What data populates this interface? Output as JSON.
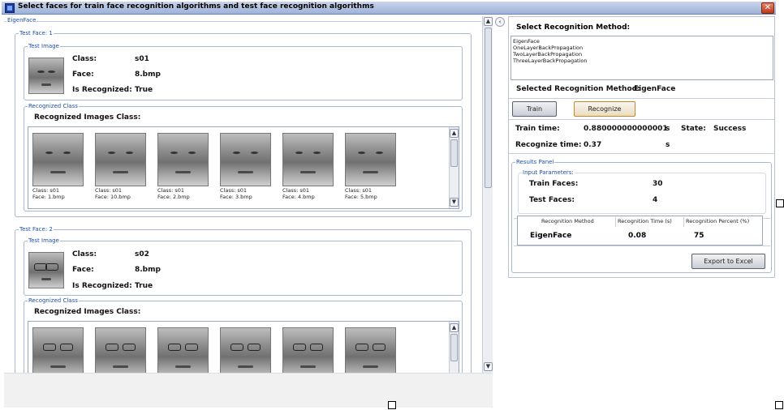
{
  "window": {
    "title": "Select faces for train face recognition algorithms and test face recognition algorithms",
    "close_glyph": "✕"
  },
  "tab": {
    "label": "EigenFace"
  },
  "tests": [
    {
      "group_label": "Test Face: 1",
      "test_image_label": "Test Image",
      "class_label": "Class:",
      "class_value": "s01",
      "face_label": "Face:",
      "face_value": "8.bmp",
      "recognized_label": "Is Recognized:",
      "recognized_value": "True",
      "recognized_class_label": "Recognized Class",
      "recognized_images_title": "Recognized Images Class:",
      "thumbs": [
        {
          "class_text": "Class: s01",
          "face_text": "Face: 1.bmp"
        },
        {
          "class_text": "Class: s01",
          "face_text": "Face: 10.bmp"
        },
        {
          "class_text": "Class: s01",
          "face_text": "Face: 2.bmp"
        },
        {
          "class_text": "Class: s01",
          "face_text": "Face: 3.bmp"
        },
        {
          "class_text": "Class: s01",
          "face_text": "Face: 4.bmp"
        },
        {
          "class_text": "Class: s01",
          "face_text": "Face: 5.bmp"
        }
      ]
    },
    {
      "group_label": "Test Face: 2",
      "test_image_label": "Test Image",
      "class_label": "Class:",
      "class_value": "s02",
      "face_label": "Face:",
      "face_value": "8.bmp",
      "recognized_label": "Is Recognized:",
      "recognized_value": "True",
      "recognized_class_label": "Recognized Class",
      "recognized_images_title": "Recognized Images Class:"
    }
  ],
  "right": {
    "select_method_title": "Select Recognition Method:",
    "methods": [
      "EigenFace",
      "OneLayerBackPropagation",
      "TwoLayerBackPropagation",
      "ThreeLayerBackPropagation"
    ],
    "selected_label": "Selected Recognition Method:",
    "selected_value": "EigenFace",
    "train_button": "Train",
    "recognize_button": "Recognize",
    "train_time_label": "Train time:",
    "train_time_value": "0.880000000000001",
    "train_time_unit": "s",
    "state_label": "State:",
    "state_value": "Success",
    "recognize_time_label": "Recognize time:",
    "recognize_time_value": "0.37",
    "recognize_time_unit": "s",
    "results_panel_label": "Results Panel",
    "input_params_label": "Input Parameters:",
    "train_faces_label": "Train Faces:",
    "train_faces_value": "30",
    "test_faces_label": "Test Faces:",
    "test_faces_value": "4",
    "table_headers": [
      "Recognition Method",
      "Recognition Time (s)",
      "Recognition Percent (%)"
    ],
    "table_row": [
      "EigenFace",
      "0.08",
      "75"
    ],
    "export_button": "Export to Excel"
  },
  "colors": {
    "accent": "#1d4fb0",
    "close": "#c0391b",
    "recognize_border": "#c28b28"
  }
}
